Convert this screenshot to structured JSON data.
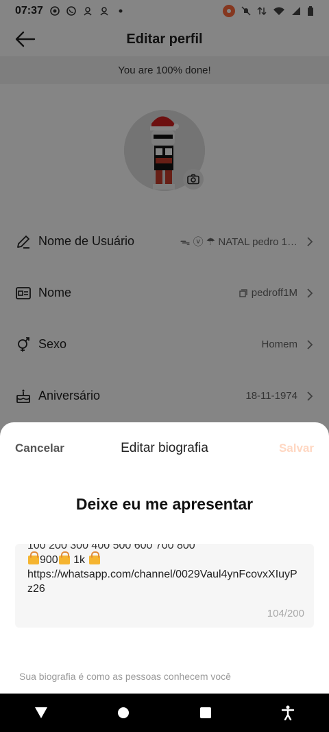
{
  "status": {
    "time": "07:37"
  },
  "header": {
    "title": "Editar perfil"
  },
  "progress": {
    "text": "You are 100% done!"
  },
  "rows": [
    {
      "label": "Nome de Usuário",
      "value": "ᯓ ⓥ ☂ NATAL   pedro 1…"
    },
    {
      "label": "Nome",
      "value": "pedroff1M"
    },
    {
      "label": "Sexo",
      "value": "Homem"
    },
    {
      "label": "Aniversário",
      "value": "18-11-1974"
    }
  ],
  "sheet": {
    "cancel": "Cancelar",
    "title": "Editar biografia",
    "save": "Salvar",
    "bio_title": "Deixe eu me apresentar",
    "bio_line1": "100 200 300 400 500 600 700 800",
    "bio_line2a": "900",
    "bio_line2b": " 1k ",
    "bio_line3": "https://whatsapp.com/channel/0029Vaul4ynFcovxXIuyPz26",
    "counter": "104/200",
    "hint": "Sua biografia é como as pessoas conhecem você"
  },
  "colors": {
    "accent": "#ff6a3d",
    "save_disabled": "#ffd7c2",
    "lock": "#f5b430"
  },
  "icons": [
    "back-arrow-icon",
    "camera-icon",
    "pen-icon",
    "id-card-icon",
    "gender-icon",
    "cake-icon",
    "chevron-right-icon",
    "copy-icon",
    "nav-back-icon",
    "nav-home-icon",
    "nav-recents-icon",
    "accessibility-icon"
  ]
}
